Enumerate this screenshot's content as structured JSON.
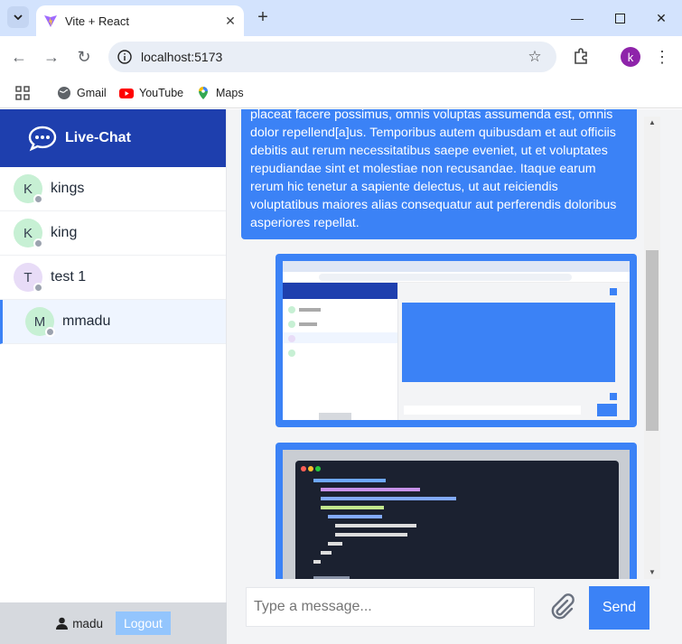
{
  "browser": {
    "tab_title": "Vite + React",
    "url": "localhost:5173",
    "profile_initial": "k",
    "bookmarks": [
      "Gmail",
      "YouTube",
      "Maps"
    ]
  },
  "app": {
    "brand": "Live-Chat",
    "users": [
      {
        "initial": "K",
        "name": "kings",
        "color": "#c7f0d4"
      },
      {
        "initial": "K",
        "name": "king",
        "color": "#c7f0d4"
      },
      {
        "initial": "T",
        "name": "test 1",
        "color": "#e8dcf7"
      },
      {
        "initial": "M",
        "name": "mmadu",
        "color": "#c7f0d4"
      }
    ],
    "current_user": "madu",
    "logout_label": "Logout"
  },
  "chat": {
    "message_text": "placeat facere possimus, omnis voluptas assumenda est, omnis dolor repellend[a]us. Temporibus autem quibusdam et aut officiis debitis aut rerum necessitatibus saepe eveniet, ut et voluptates repudiandae sint et molestiae non recusandae. Itaque earum rerum hic tenetur a sapiente delectus, ut aut reiciendis voluptatibus maiores alias consequatur aut perferendis doloribus asperiores repellat.",
    "input_placeholder": "Type a message...",
    "send_label": "Send"
  },
  "colors": {
    "brand_bar": "#1e3fae",
    "bubble": "#3b82f6",
    "logout": "#93c5fd"
  }
}
